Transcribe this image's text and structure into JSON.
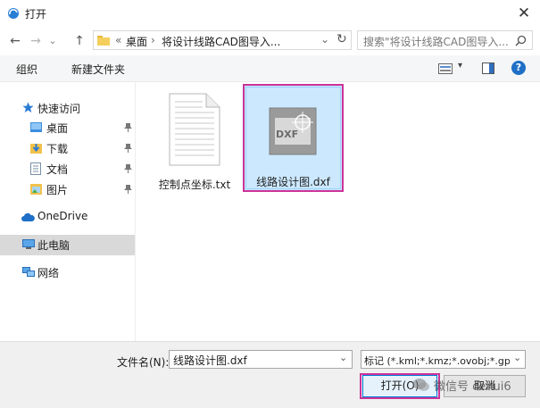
{
  "window": {
    "title": "打开",
    "close_glyph": "✕",
    "accent": "#0078d7"
  },
  "nav_buttons": {
    "back": "←",
    "forward": "→",
    "dropdown": "⌄",
    "up": "↑",
    "refresh": "↻"
  },
  "address": {
    "overflow": "«",
    "crumb1": "桌面",
    "sep": "›",
    "crumb2": "将设计线路CAD图导入...",
    "dropdown": "⌄"
  },
  "search": {
    "placeholder": "搜索\"将设计线路CAD图导入..."
  },
  "toolbar": {
    "organize": "组织",
    "new_folder": "新建文件夹",
    "dropdown": "▾",
    "help": "?"
  },
  "sidebar": {
    "quick_access": "快速访问",
    "items": [
      {
        "label": "桌面",
        "pinned": true
      },
      {
        "label": "下载",
        "pinned": true
      },
      {
        "label": "文档",
        "pinned": true
      },
      {
        "label": "图片",
        "pinned": true
      }
    ],
    "onedrive": "OneDrive",
    "this_pc": "此电脑",
    "network": "网络"
  },
  "files": [
    {
      "name": "控制点坐标.txt",
      "type": "txt",
      "selected": false
    },
    {
      "name": "线路设计图.dxf",
      "type": "dxf",
      "icon_text": "DXF",
      "selected": true
    }
  ],
  "bottom": {
    "filename_label": "文件名(N):",
    "filename_value": "线路设计图.dxf",
    "filter_value": "标记 (*.kml;*.kmz;*.ovobj;*.gps",
    "open_label": "打开(O)",
    "cancel_label": "取消"
  },
  "watermark": {
    "text": "微信号 cehui6"
  },
  "colors": {
    "highlight": "#cc3399",
    "selection_bg": "#cce8ff",
    "selection_border": "#99d1ff"
  }
}
